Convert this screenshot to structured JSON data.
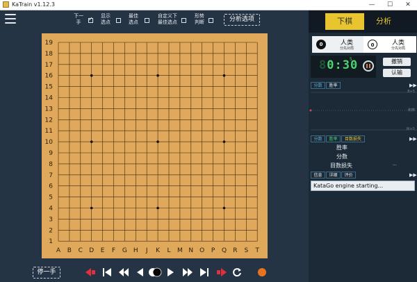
{
  "window": {
    "title": "KaTrain v1.12.3"
  },
  "toolbar": {
    "options": [
      {
        "label": "下一\n手",
        "checked": true
      },
      {
        "label": "显示\n选点",
        "checked": false
      },
      {
        "label": "最佳\n选点",
        "checked": false
      },
      {
        "label": "自定义下\n最佳选点",
        "checked": false
      },
      {
        "label": "形势\n判断",
        "checked": false
      }
    ],
    "analysis_options_label": "分析选项"
  },
  "board": {
    "columns": [
      "A",
      "B",
      "C",
      "D",
      "E",
      "F",
      "G",
      "H",
      "J",
      "K",
      "L",
      "M",
      "N",
      "O",
      "P",
      "Q",
      "R",
      "S",
      "T"
    ],
    "rows": [
      "19",
      "18",
      "17",
      "16",
      "15",
      "14",
      "13",
      "12",
      "11",
      "10",
      "9",
      "8",
      "7",
      "6",
      "5",
      "4",
      "3",
      "2",
      "1"
    ],
    "hoshi": [
      "D16",
      "K16",
      "Q16",
      "D10",
      "K10",
      "Q10",
      "D4",
      "K4",
      "Q4"
    ]
  },
  "mode": {
    "play_label": "下棋",
    "analyze_label": "分析"
  },
  "players": [
    {
      "stone_label": "0",
      "name": "人类",
      "sub": "分先对局"
    },
    {
      "stone_label": "0",
      "name": "人类",
      "sub": "分先对局"
    }
  ],
  "timer": {
    "prefix": "8",
    "value": "0:30",
    "superscript": "5"
  },
  "actions": {
    "undo_label": "撤销",
    "resign_label": "认输"
  },
  "graph_tabs": [
    "分数",
    "胜率"
  ],
  "graph_labels": {
    "top": "B+5",
    "mid": "和棋",
    "bottom": "W+5"
  },
  "stat_tabs": [
    "分数",
    "胜率",
    "目数损失"
  ],
  "stats": {
    "winrate": "胜率",
    "score": "分数",
    "points_lost": "目数损失",
    "more": "..."
  },
  "info_tabs": [
    "信息",
    "详细",
    "评价"
  ],
  "console": {
    "message": "KataGo engine starting..."
  },
  "bottom": {
    "pass_label": "停一手"
  }
}
